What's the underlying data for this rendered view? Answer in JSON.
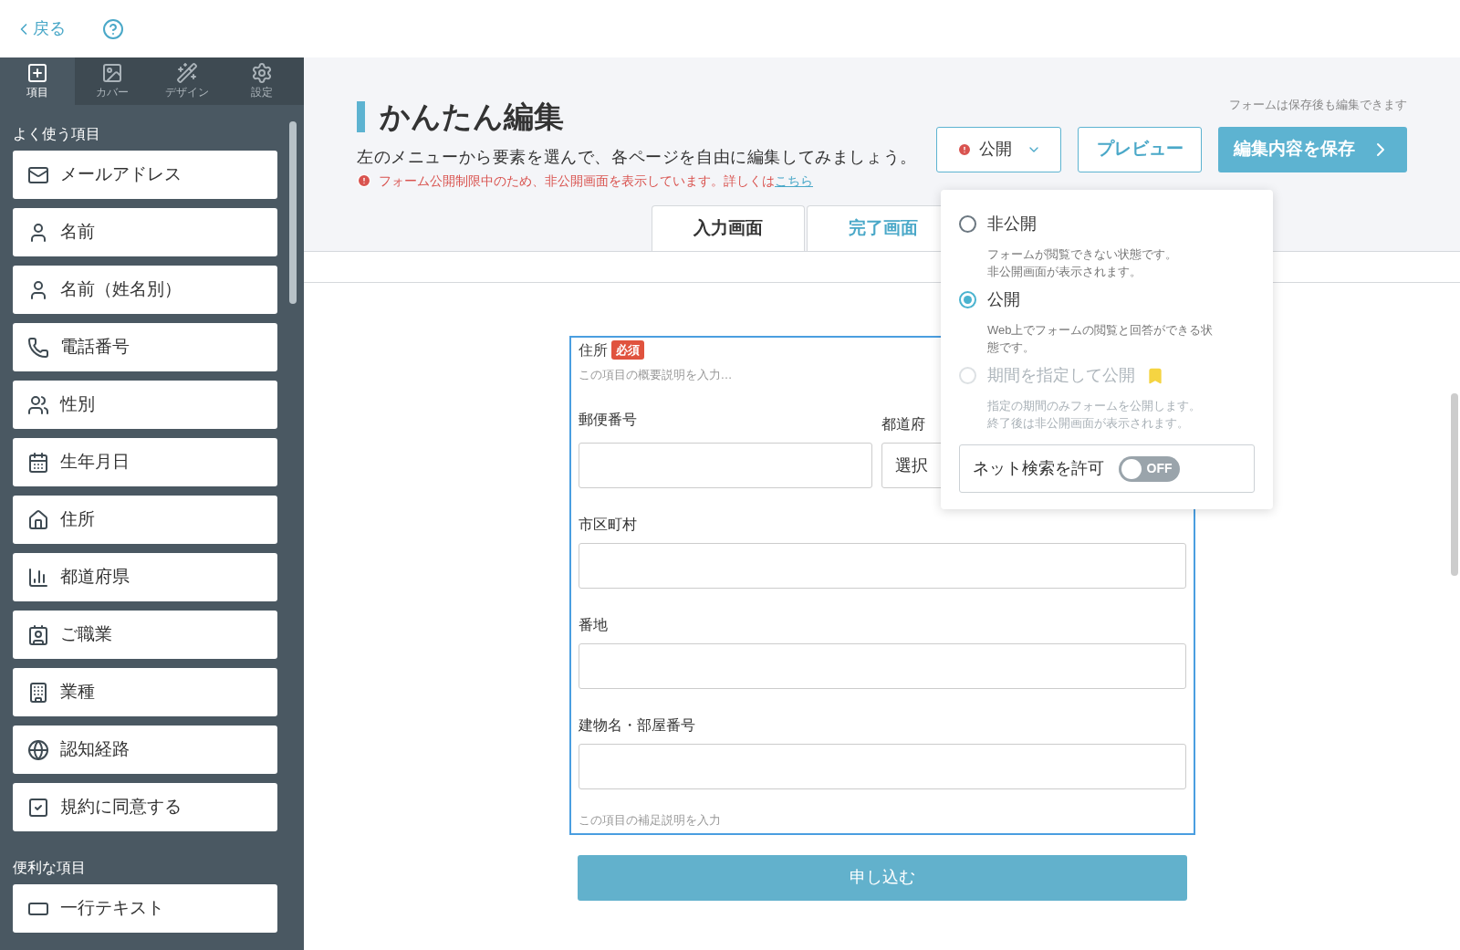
{
  "top_bar": {
    "back": "戻る"
  },
  "sidebar": {
    "tabs": [
      {
        "label": "項目",
        "selected": true
      },
      {
        "label": "カバー",
        "selected": false
      },
      {
        "label": "デザイン",
        "selected": false
      },
      {
        "label": "設定",
        "selected": false
      }
    ],
    "sections": [
      {
        "title": "よく使う項目",
        "items": [
          "メールアドレス",
          "名前",
          "名前（姓名別）",
          "電話番号",
          "性別",
          "生年月日",
          "住所",
          "都道府県",
          "ご職業",
          "業種",
          "認知経路",
          "規約に同意する"
        ]
      },
      {
        "title": "便利な項目",
        "items": [
          "一行テキスト"
        ]
      }
    ]
  },
  "header": {
    "title": "かんたん編集",
    "hint": "フォームは保存後も編集できます",
    "subtitle": "左のメニューから要素を選んで、各ページを自由に編集してみましょう。",
    "warning": "フォーム公開制限中のため、非公開画面を表示しています。詳しくは",
    "warning_link": "こちら"
  },
  "actions": {
    "status": "公開",
    "preview": "プレビュー",
    "save": "編集内容を保存"
  },
  "page_tabs": [
    {
      "label": "入力画面",
      "selected": true
    },
    {
      "label": "完了画面",
      "selected": false
    }
  ],
  "form": {
    "label": "住所",
    "required": "必須",
    "description_placeholder": "この項目の概要説明を入力…",
    "fields": [
      {
        "label": "郵便番号"
      },
      {
        "label": "市区町村"
      },
      {
        "label": "番地"
      },
      {
        "label": "建物名・部屋番号"
      }
    ],
    "prefecture": {
      "label": "都道府",
      "value": "選択"
    },
    "note_placeholder": "この項目の補足説明を入力",
    "submit": "申し込む"
  },
  "publish_menu": {
    "options": [
      {
        "label": "非公開",
        "description_lines": [
          "フォームが閲覧できない状態です。",
          "非公開画面が表示されます。"
        ],
        "selected": false,
        "disabled": false,
        "premium": false
      },
      {
        "label": "公開",
        "description_lines": [
          "Web上でフォームの閲覧と回答ができる状",
          "態です。"
        ],
        "selected": true,
        "disabled": false,
        "premium": false
      },
      {
        "label": "期間を指定して公開",
        "description_lines": [
          "指定の期間のみフォームを公開します。",
          "終了後は非公開画面が表示されます。"
        ],
        "selected": false,
        "disabled": true,
        "premium": true
      }
    ],
    "search_toggle": {
      "label": "ネット検索を許可",
      "on": false,
      "state_text": "OFF"
    }
  }
}
